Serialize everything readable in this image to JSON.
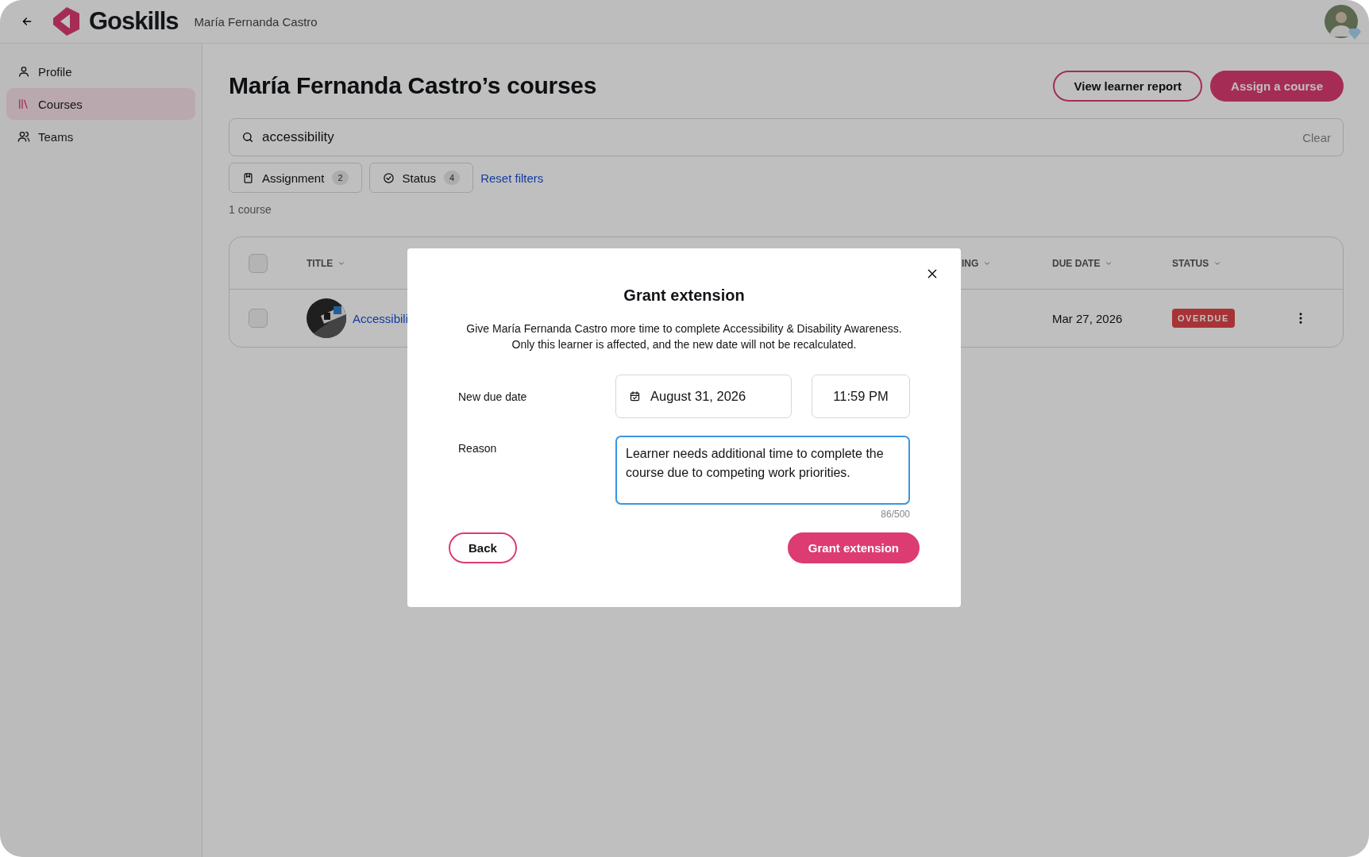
{
  "header": {
    "logo": "Goskills",
    "learner_name": "María Fernanda Castro"
  },
  "sidebar": {
    "items": [
      {
        "label": "Profile",
        "kind": "person",
        "selected": false
      },
      {
        "label": "Courses",
        "kind": "books",
        "selected": true
      },
      {
        "label": "Teams",
        "kind": "people",
        "selected": false
      }
    ]
  },
  "page": {
    "title": "María Fernanda Castro’s courses",
    "buttons": [
      {
        "label": "View learner report",
        "kind": "outline"
      },
      {
        "label": "Assign a course",
        "kind": "primary"
      }
    ]
  },
  "search": {
    "value": "accessibility",
    "clear": "Clear"
  },
  "filters": [
    {
      "label": "Assignment",
      "count": "2",
      "kind": "bookmark"
    },
    {
      "label": "Status",
      "count": "4",
      "kind": "check"
    }
  ],
  "reset_filters": "Reset filters",
  "result_count": "1 course",
  "table": {
    "header_checked": false,
    "columns": [
      {
        "label": "TITLE"
      },
      {
        "label": "ING"
      },
      {
        "label": "DUE DATE"
      },
      {
        "label": "STATUS"
      }
    ],
    "rows": [
      {
        "checked": false,
        "title": "Accessibili",
        "due_date": "Mar 27, 2026",
        "status": "OVERDUE"
      }
    ]
  },
  "modal": {
    "title": "Grant extension",
    "description": [
      "Give María Fernanda Castro more time to complete Accessibility & Disability Awareness.",
      "Only this learner is affected, and the new date will not be recalculated."
    ],
    "due_label": "New due date",
    "date": "August 31, 2026",
    "time": "11:59 PM",
    "reason_label": "Reason",
    "reason": "Learner needs additional time to complete the course due to competing work priorities.",
    "counter": "86/500",
    "back": "Back",
    "submit": "Grant extension"
  }
}
